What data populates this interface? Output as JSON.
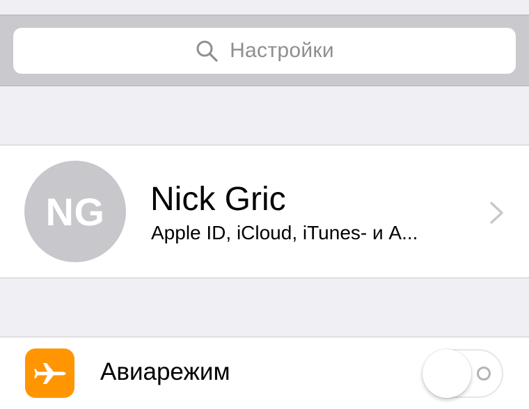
{
  "search": {
    "placeholder": "Настройки",
    "icon": "search-icon"
  },
  "profile": {
    "initials": "NG",
    "name": "Nick Gric",
    "subtitle": "Apple ID, iCloud, iTunes- и A...",
    "disclosure_icon": "chevron-right-icon"
  },
  "settings": {
    "items": [
      {
        "label": "Авиарежим",
        "icon": "airplane-icon",
        "icon_color": "#ff9500",
        "toggle_on": false
      }
    ]
  },
  "colors": {
    "background": "#efeff4",
    "search_bar": "#c9c9ce",
    "avatar": "#c7c7cc",
    "accent_orange": "#ff9500",
    "placeholder_text": "#8e8e93"
  }
}
